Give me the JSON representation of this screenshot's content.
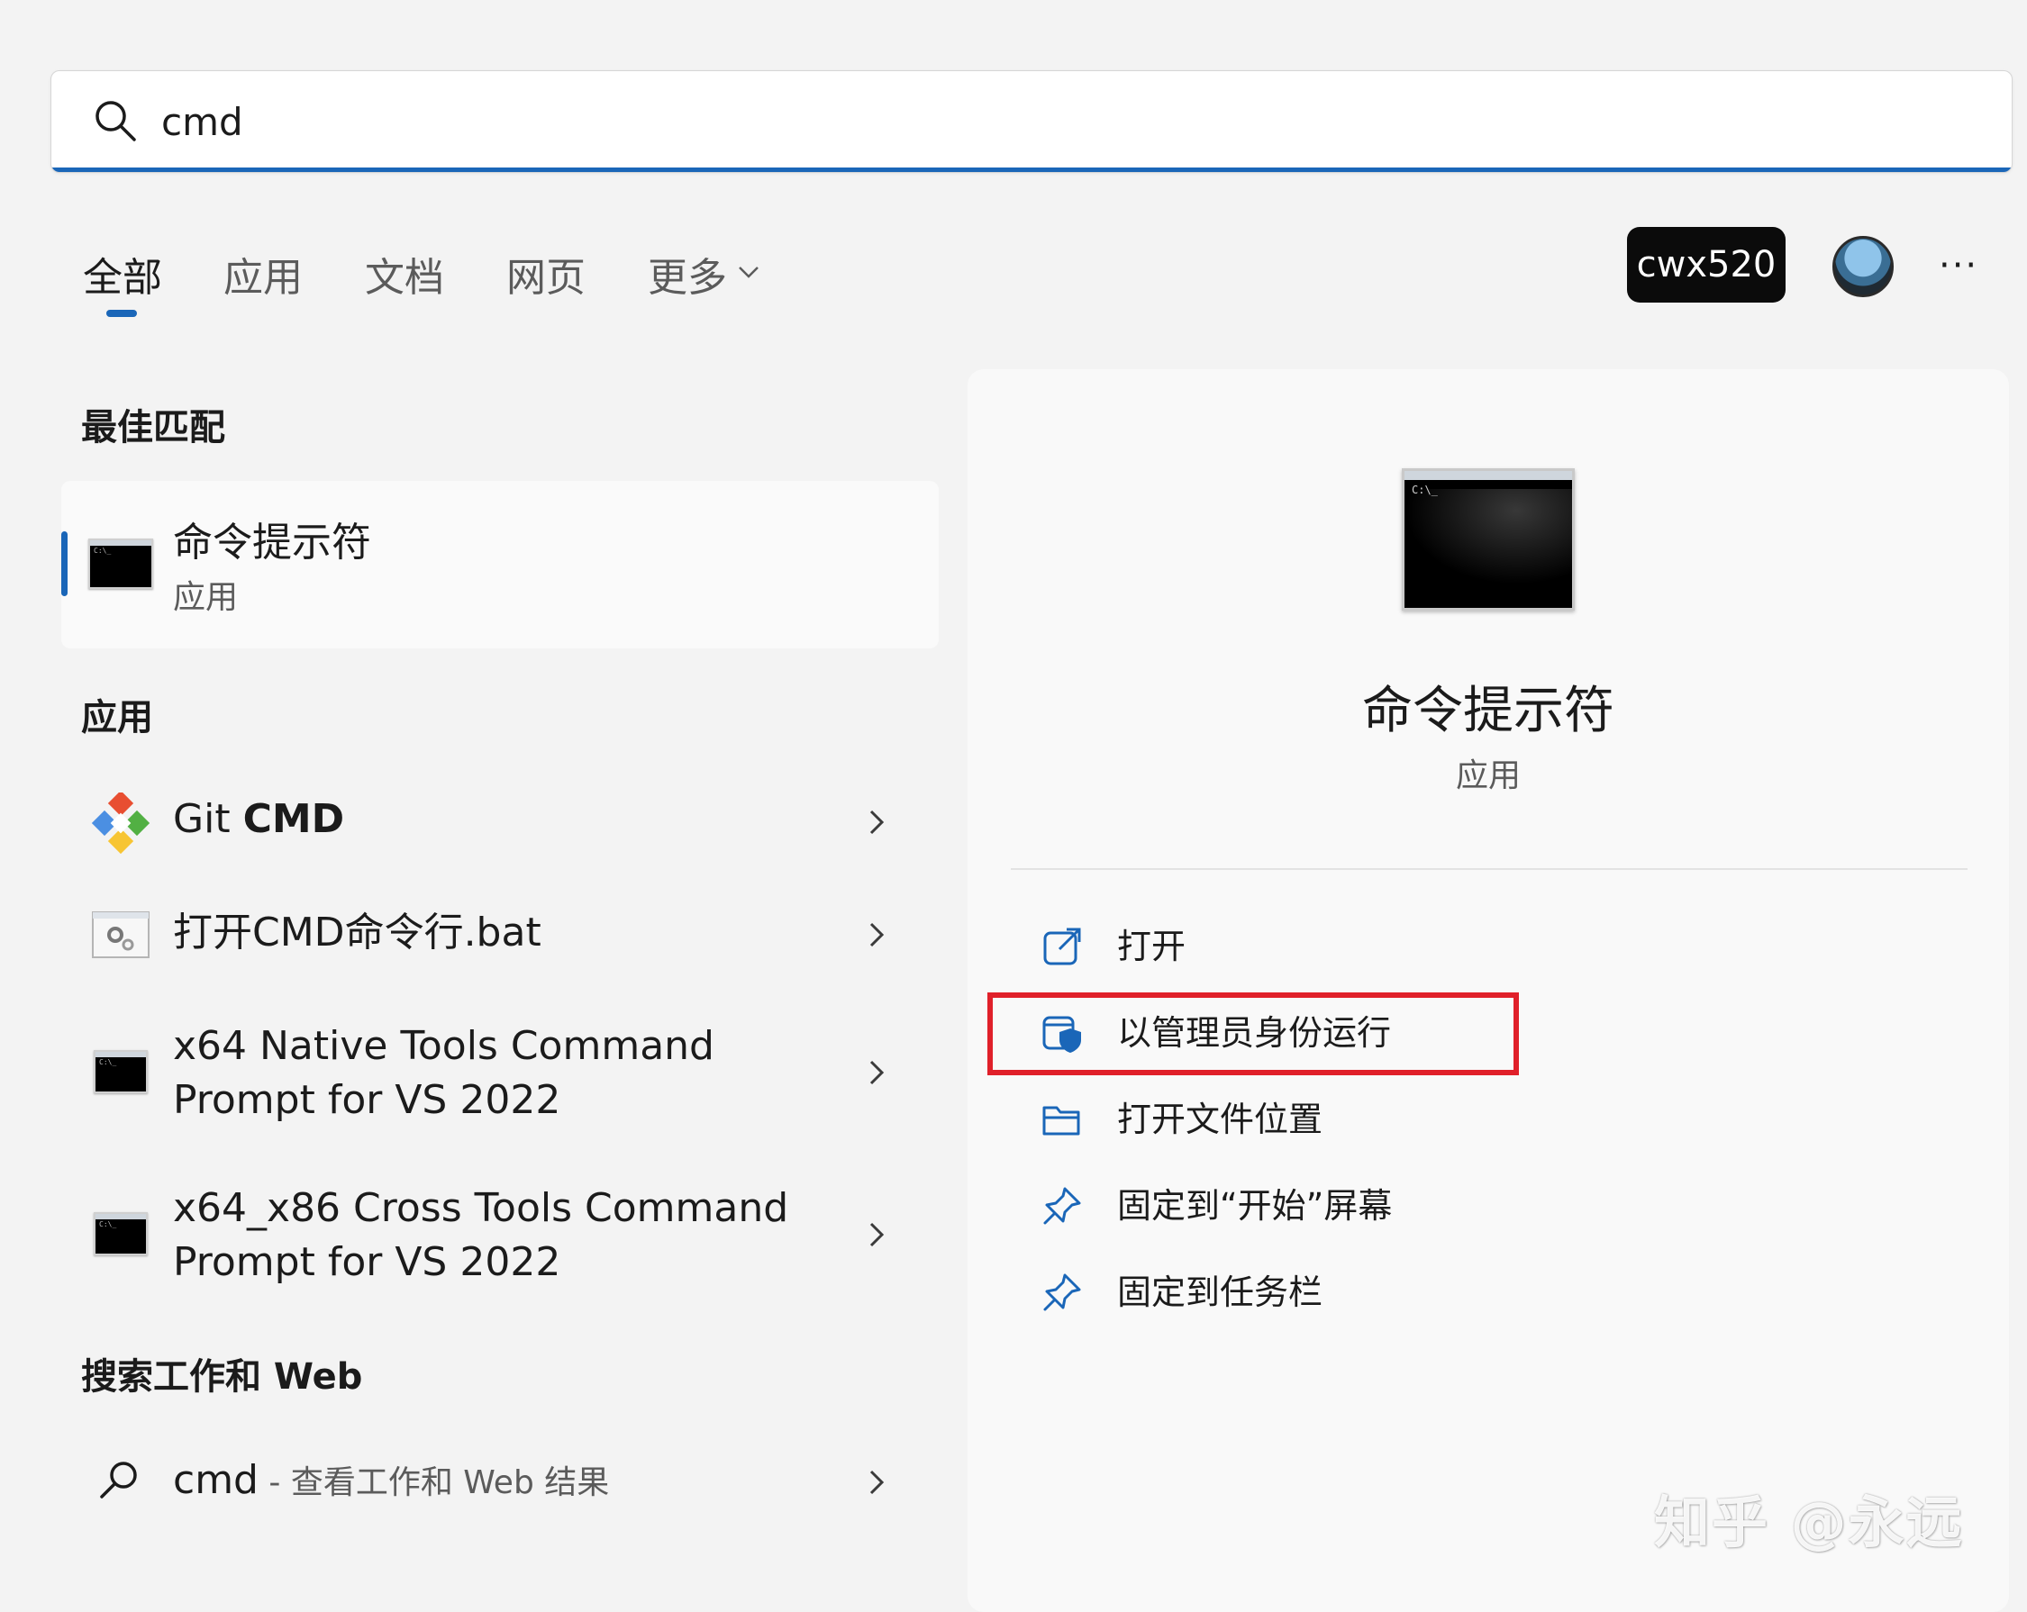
{
  "search": {
    "value": "cmd"
  },
  "tabs": [
    {
      "label": "全部",
      "active": true
    },
    {
      "label": "应用"
    },
    {
      "label": "文档"
    },
    {
      "label": "网页"
    },
    {
      "label": "更多"
    }
  ],
  "user": {
    "name": "cwx520"
  },
  "more_label": "···",
  "best_match": {
    "section": "最佳匹配",
    "name": "命令提示符",
    "type": "应用"
  },
  "apps": {
    "section": "应用",
    "items": [
      {
        "name_plain": "Git ",
        "name_bold": "CMD",
        "icon": "git-icon"
      },
      {
        "name": "打开CMD命令行.bat",
        "icon": "batch-file-icon"
      },
      {
        "line1": "x64 Native Tools Command",
        "line2": "Prompt for VS 2022",
        "icon": "cmd-icon"
      },
      {
        "line1": "x64_x86 Cross Tools Command",
        "line2": "Prompt for VS 2022",
        "icon": "cmd-icon"
      }
    ]
  },
  "web": {
    "section": "搜索工作和 Web",
    "query": "cmd",
    "suffix": " - 查看工作和 Web 结果"
  },
  "detail": {
    "name": "命令提示符",
    "type": "应用",
    "icon_text": "C:\\_",
    "actions": [
      {
        "label": "打开",
        "icon": "open-external-icon"
      },
      {
        "label": "以管理员身份运行",
        "icon": "shield-icon",
        "highlighted": true
      },
      {
        "label": "打开文件位置",
        "icon": "folder-icon"
      },
      {
        "label": "固定到“开始”屏幕",
        "icon": "pin-icon"
      },
      {
        "label": "固定到任务栏",
        "icon": "pin-icon"
      }
    ]
  },
  "watermark": "知乎 @永远",
  "colors": {
    "accent": "#1a66b8",
    "highlight": "#e0202a"
  }
}
